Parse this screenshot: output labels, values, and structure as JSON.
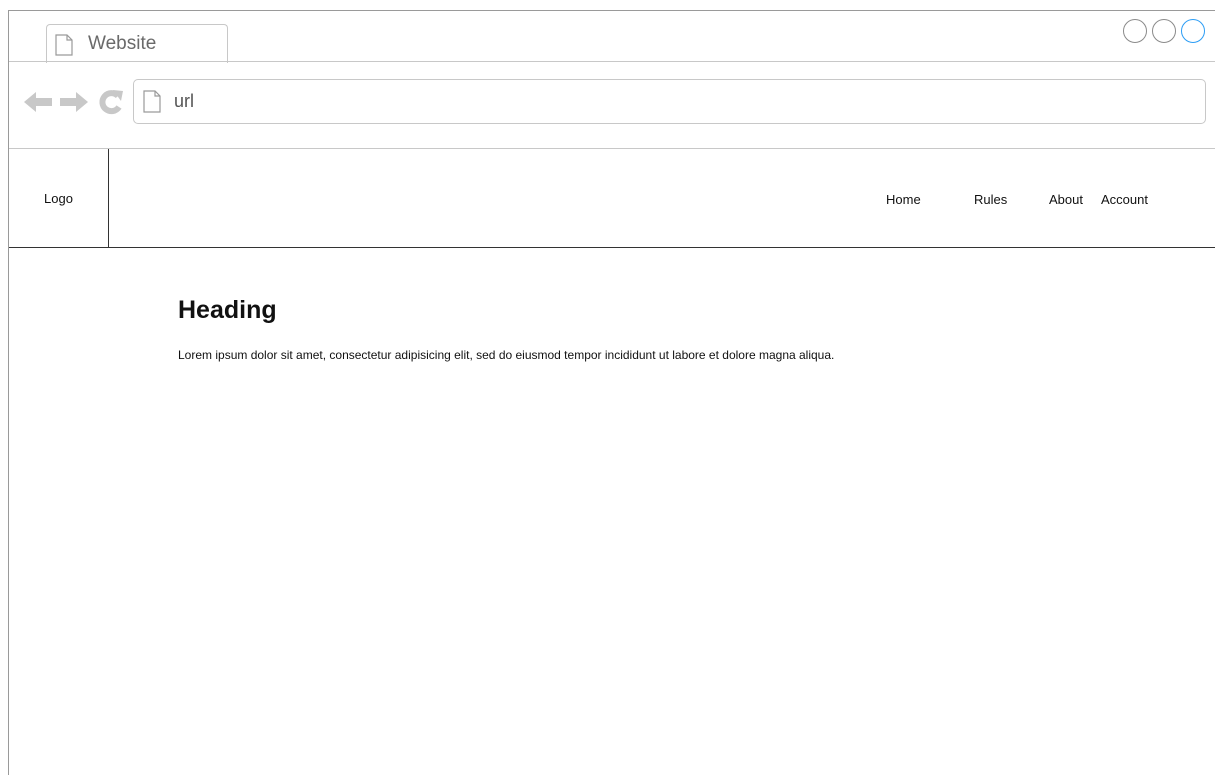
{
  "browser": {
    "tab_title": "Website",
    "url_text": "url"
  },
  "icons": {
    "back": "back-arrow-icon",
    "forward": "forward-arrow-icon",
    "reload": "reload-icon",
    "page": "page-icon"
  },
  "colors": {
    "window_control_active": "#2c9df5",
    "nav_icon_gray": "#c8c8c8"
  },
  "site": {
    "logo": "Logo",
    "nav": [
      "Home",
      "Rules",
      "About",
      "Account"
    ]
  },
  "content": {
    "heading": "Heading",
    "paragraph": "Lorem ipsum dolor sit amet, consectetur adipisicing elit, sed do eiusmod tempor incididunt ut labore et dolore magna aliqua."
  }
}
